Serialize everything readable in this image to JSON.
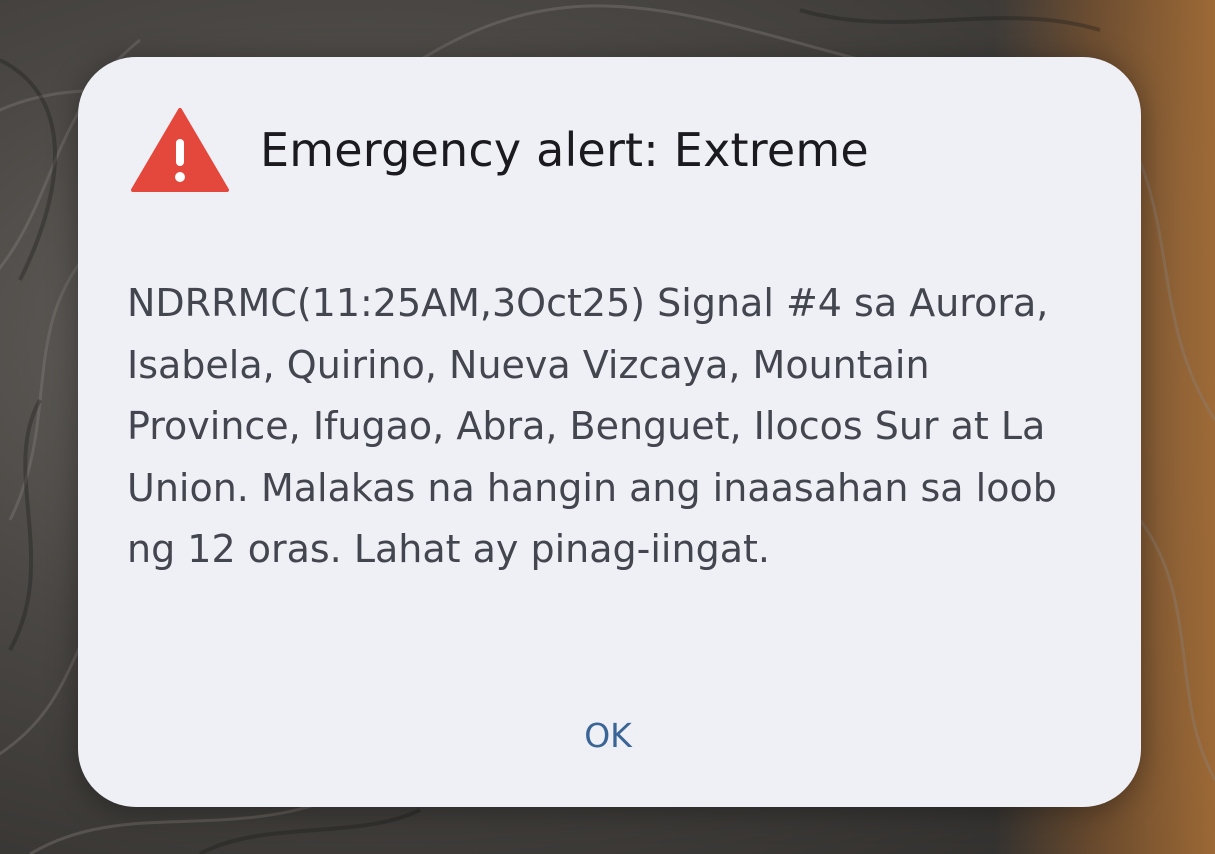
{
  "dialog": {
    "icon": "warning-triangle-icon",
    "title": "Emergency alert: Extreme",
    "message": "NDRRMC(11:25AM,3Oct25) Signal #4 sa Aurora, Isabela, Quirino, Nueva Vizcaya, Mountain Province, Ifugao, Abra, Benguet, Ilocos Sur at La Union. Malakas na hangin ang inaasahan sa loob ng 12 oras. Lahat ay pinag-iingat.",
    "ok_label": "OK"
  },
  "colors": {
    "dialog_background": "#efeff6",
    "alert_icon": "#e4473b",
    "button_text": "#3a6596",
    "title_text": "#1b1b1f",
    "body_text": "#44464f"
  }
}
